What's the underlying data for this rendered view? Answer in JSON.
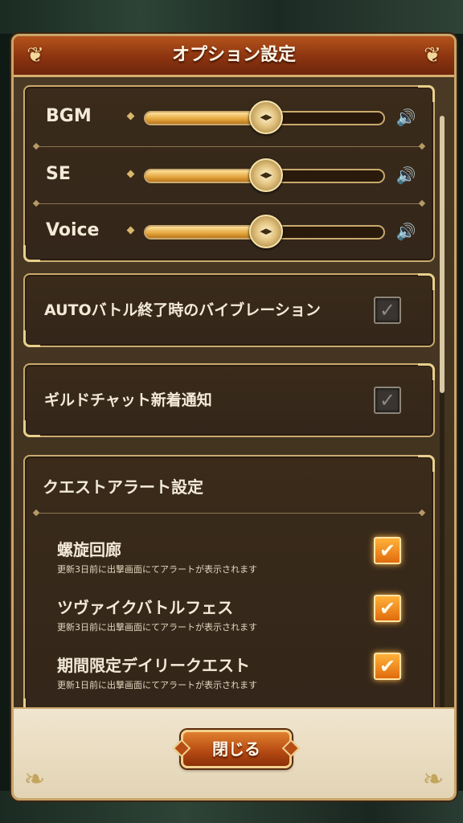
{
  "dialog": {
    "title": "オプション設定",
    "close_label": "閉じる"
  },
  "volume": {
    "items": [
      {
        "label": "BGM",
        "level_percent": 50
      },
      {
        "label": "SE",
        "level_percent": 50
      },
      {
        "label": "Voice",
        "level_percent": 50
      }
    ],
    "knob_glyph": "◂▸",
    "speaker_glyph": "🔊"
  },
  "toggles": {
    "auto_vibration": {
      "label": "AUTOバトル終了時のバイブレーション",
      "checked": false
    },
    "guild_chat_notify": {
      "label": "ギルドチャット新着通知",
      "checked": false
    }
  },
  "quest_alert": {
    "title": "クエストアラート設定",
    "items": [
      {
        "name": "螺旋回廊",
        "desc": "更新3日前に出撃画面にてアラートが表示されます",
        "checked": true
      },
      {
        "name": "ツヴァイクバトルフェス",
        "desc": "更新3日前に出撃画面にてアラートが表示されます",
        "checked": true
      },
      {
        "name": "期間限定デイリークエスト",
        "desc": "更新1日前に出撃画面にてアラートが表示されます",
        "checked": true
      }
    ]
  },
  "glyphs": {
    "check_on": "✔",
    "check_off": "✓",
    "corner_ornament": "❦",
    "footer_ornament": "❧"
  },
  "colors": {
    "header": "#8c3410",
    "panel_border": "#c9a96e",
    "slider_fill": "#e3a43b",
    "checkbox_on": "#f08a1c",
    "button": "#b84c14"
  }
}
